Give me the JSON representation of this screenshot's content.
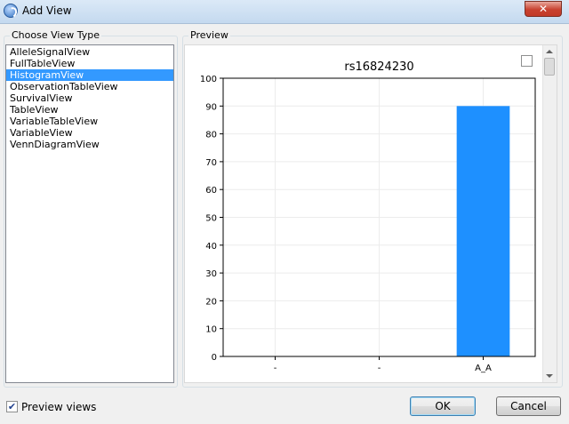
{
  "window": {
    "title": "Add View",
    "close_label": "✕"
  },
  "left_group": {
    "label": "Choose View Type",
    "items": [
      "AlleleSignalView",
      "FullTableView",
      "HistogramView",
      "ObservationTableView",
      "SurvivalView",
      "TableView",
      "VariableTableView",
      "VariableView",
      "VennDiagramView"
    ],
    "selected_index": 2
  },
  "right_group": {
    "label": "Preview"
  },
  "footer": {
    "preview_checkbox_label": "Preview views",
    "preview_checked": true,
    "ok_label": "OK",
    "cancel_label": "Cancel"
  },
  "chart_data": {
    "type": "bar",
    "title": "rs16824230",
    "categories": [
      "-",
      "-",
      "A_A"
    ],
    "values": [
      0,
      0,
      90
    ],
    "ylim": [
      0,
      100
    ],
    "yticks": [
      0,
      10,
      20,
      30,
      40,
      50,
      60,
      70,
      80,
      90,
      100
    ],
    "grid": true,
    "bar_color": "#1e90ff",
    "xlabel": "",
    "ylabel": ""
  }
}
